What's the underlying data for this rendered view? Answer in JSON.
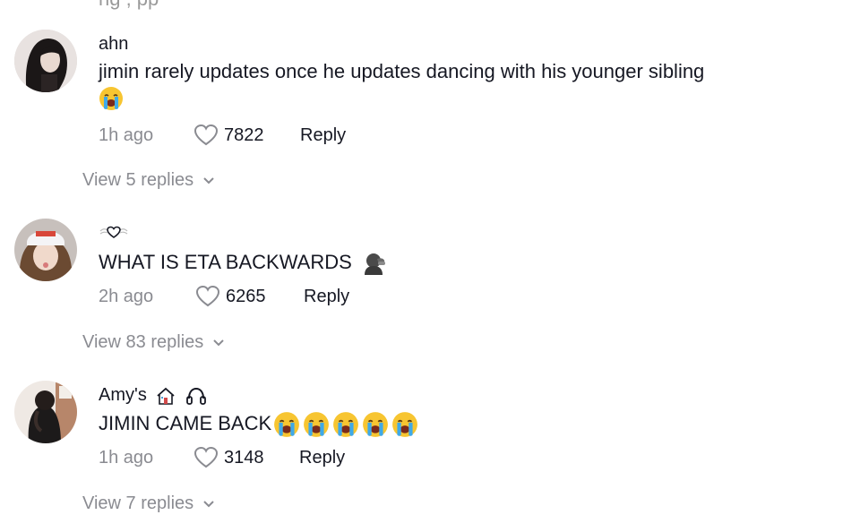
{
  "partial_header_text": "ng   ,   pp",
  "comments": [
    {
      "username": "ahn",
      "text": "jimin rarely updates once he updates dancing with his younger sibling",
      "time": "1h ago",
      "likes": "7822",
      "reply_label": "Reply",
      "view_replies": "View 5 replies",
      "emoji": "loudly-crying-face"
    },
    {
      "username": "",
      "username_icon": "heart-with-wings-icon",
      "text": "WHAT IS ETA BACKWARDS",
      "text_emoji": "person-face-palm-icon",
      "time": "2h ago",
      "likes": "6265",
      "reply_label": "Reply",
      "view_replies": "View 83 replies"
    },
    {
      "username": "Amy's",
      "username_icons": [
        "house-icon",
        "headphones-icon"
      ],
      "text": "JIMIN CAME BACK",
      "emoji_count": 5,
      "emoji": "loudly-crying-face",
      "time": "1h ago",
      "likes": "3148",
      "reply_label": "Reply",
      "view_replies": "View 7 replies"
    }
  ],
  "colors": {
    "text": "#161823",
    "muted": "#8a8b91",
    "emoji_yellow": "#f7c531",
    "emoji_tear": "#3fa9e8"
  }
}
